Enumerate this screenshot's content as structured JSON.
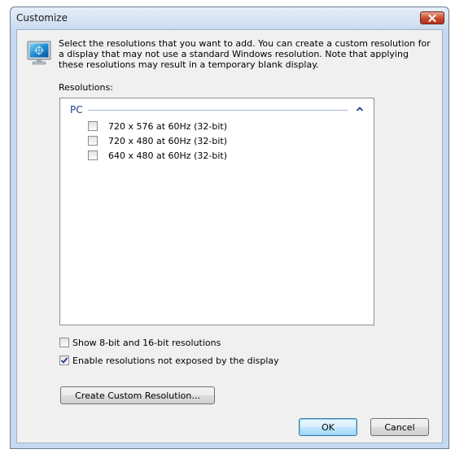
{
  "window": {
    "title": "Customize"
  },
  "description": "Select the resolutions that you want to add. You can create a custom resolution for a display that may not use a standard Windows resolution. Note that applying these resolutions may result in a temporary blank display.",
  "resolutions": {
    "label": "Resolutions:",
    "group": "PC",
    "items": [
      {
        "label": "720 x 576 at 60Hz (32-bit)",
        "checked": false
      },
      {
        "label": "720 x 480 at 60Hz (32-bit)",
        "checked": false
      },
      {
        "label": "640 x 480 at 60Hz (32-bit)",
        "checked": false
      }
    ]
  },
  "options": {
    "show_8_16_bit": {
      "label": "Show 8-bit and 16-bit resolutions",
      "checked": false
    },
    "enable_unexposed": {
      "label": "Enable resolutions not exposed by the display",
      "checked": true
    }
  },
  "buttons": {
    "create_custom": "Create Custom Resolution...",
    "ok": "OK",
    "cancel": "Cancel"
  }
}
